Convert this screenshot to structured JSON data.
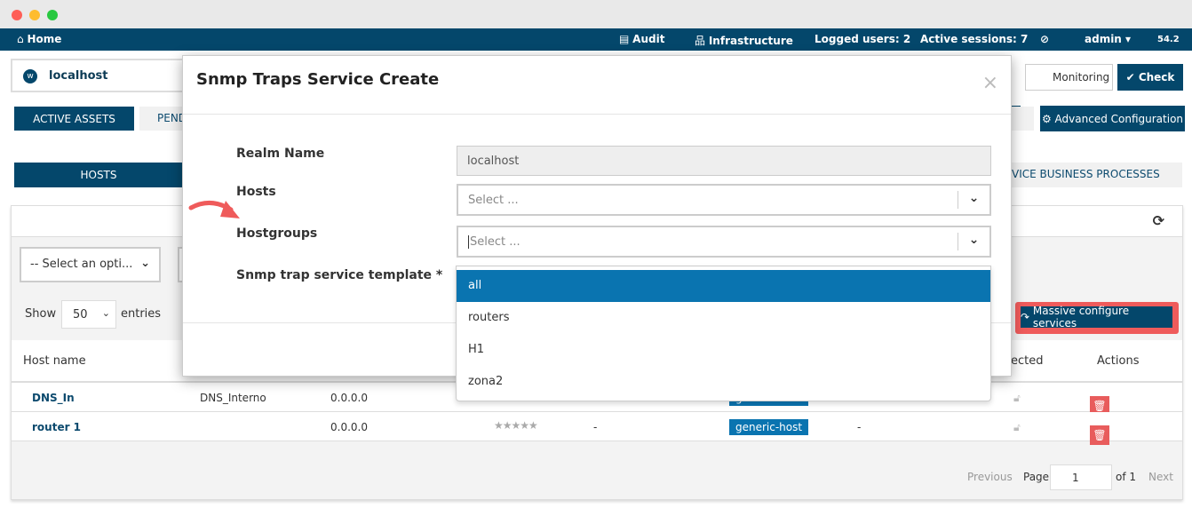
{
  "nav": {
    "home": "Home",
    "audit": "Audit",
    "infrastructure": "Infrastructure",
    "logged_users": "Logged users: 2",
    "active_sessions": "Active sessions: 7",
    "user": "admin",
    "version": "54.2"
  },
  "realm": {
    "name": "localhost",
    "monitoring": "Monitoring",
    "check": "Check"
  },
  "tabs": {
    "active_assets": "ACTIVE ASSETS",
    "pending": "PEND",
    "advanced": "Advanced Configuration"
  },
  "subtabs": {
    "hosts": "HOSTS",
    "business": "VICE BUSINESS PROCESSES"
  },
  "filters": {
    "select_option": "-- Select an opti...",
    "show": "Show",
    "entries_value": "50",
    "entries": "entries",
    "massive": "Massive configure services"
  },
  "table": {
    "headers": {
      "host_name": "Host name",
      "protected": "ected",
      "actions": "Actions"
    },
    "rows": [
      {
        "name": "DNS_In",
        "alias": "DNS_Interno",
        "address": "0.0.0.0",
        "template": "generic-host",
        "extra": ""
      },
      {
        "name": "router 1",
        "alias": "",
        "address": "0.0.0.0",
        "template": "generic-host",
        "extra": "-",
        "dash": "-"
      }
    ]
  },
  "pagination": {
    "previous": "Previous",
    "page": "Page",
    "current": "1",
    "of": "of 1",
    "next": "Next"
  },
  "modal": {
    "title": "Snmp Traps Service Create",
    "close": "×",
    "fields": {
      "realm_label": "Realm Name",
      "realm_value": "localhost",
      "hosts_label": "Hosts",
      "hosts_placeholder": "Select ...",
      "hostgroups_label": "Hostgroups",
      "hostgroups_placeholder": "Select ...",
      "template_label": "Snmp trap service template *"
    },
    "options": [
      "all",
      "routers",
      "H1",
      "zona2"
    ],
    "selected_option": "all"
  },
  "colors": {
    "primary": "#04476b",
    "highlight": "#0a74b0",
    "danger": "#e85c5c",
    "annotation": "#ef5b5b"
  }
}
